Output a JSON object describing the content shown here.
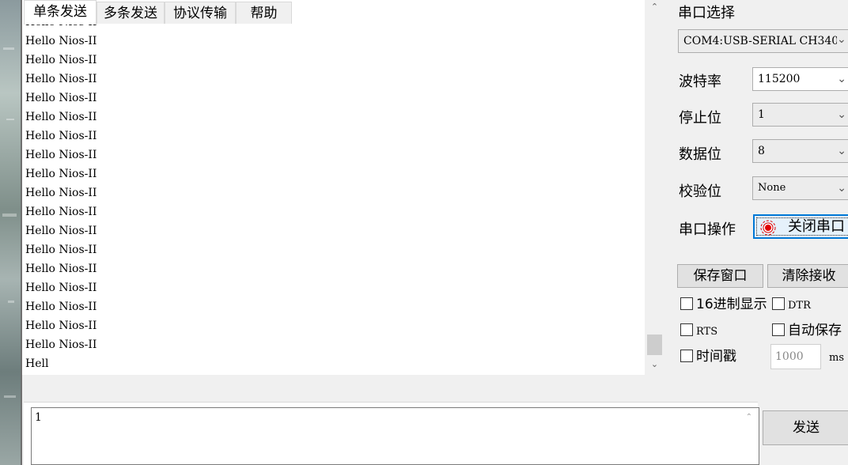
{
  "receive": {
    "lines": [
      "Hello Nios-II",
      "Hello Nios-II",
      "Hello Nios-II",
      "Hello Nios-II",
      "Hello Nios-II",
      "Hello Nios-II",
      "Hello Nios-II",
      "Hello Nios-II",
      "Hello Nios-II",
      "Hello Nios-II",
      "Hello Nios-II",
      "Hello Nios-II",
      "Hello Nios-II",
      "Hello Nios-II",
      "Hello Nios-II",
      "Hello Nios-II",
      "Hello Nios-II",
      "Hello Nios-II",
      "Hello Nios-II",
      "Hell"
    ]
  },
  "tabs": [
    "单条发送",
    "多条发送",
    "协议传输",
    "帮助"
  ],
  "send": {
    "text": "1",
    "send_label": "发送"
  },
  "settings": {
    "port_label": "串口选择",
    "port_value": "COM4:USB-SERIAL CH340",
    "baud_label": "波特率",
    "baud_value": "115200",
    "stop_label": "停止位",
    "stop_value": "1",
    "data_label": "数据位",
    "data_value": "8",
    "parity_label": "校验位",
    "parity_value": "None",
    "op_label": "串口操作",
    "op_button": "关闭串口"
  },
  "actions": {
    "save_window": "保存窗口",
    "clear_recv": "清除接收"
  },
  "options": {
    "hex_display": "16进制显示",
    "dtr": "DTR",
    "rts": "RTS",
    "auto_save": "自动保存",
    "timestamp": "时间戳",
    "interval": "1000",
    "unit": "ms"
  },
  "colors": {
    "accent": "#0078d7",
    "led": "#e00000"
  }
}
